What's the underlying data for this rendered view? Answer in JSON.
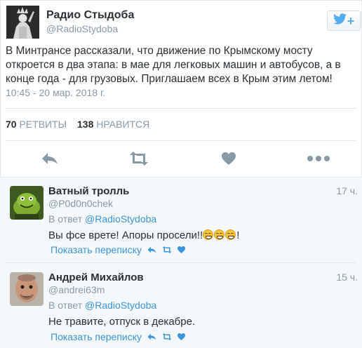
{
  "tweet": {
    "author_name": "Радио Стыдоба",
    "author_handle": "@RadioStydoba",
    "text": "В Минтрансе рассказали, что движение по Крымскому мосту откроется в два этапа: в мае для легковых машин и автобусов, а в конце года - для грузовых. Приглашаем всех в Крым этим летом!",
    "timestamp": "10:45 - 20 мар. 2018 г.",
    "retweets_count": "70",
    "retweets_label": "РЕТВИТЫ",
    "likes_count": "138",
    "likes_label": "НРАВИТСЯ",
    "follow_plus": "+"
  },
  "replies": [
    {
      "name": "Ватный тролль",
      "handle": "@P0d0n0chek",
      "time": "17 ч.",
      "in_reply_prefix": "В ответ",
      "in_reply_to": "@RadioStydoba",
      "text_start": "Вы фсе врете! Апоры просели!!",
      "text_end": "!",
      "show_conversation": "Показать переписку"
    },
    {
      "name": "Андрей Михайлов",
      "handle": "@andrei63m",
      "time": "15 ч.",
      "in_reply_prefix": "В ответ",
      "in_reply_to": "@RadioStydoba",
      "text": "Не травите, отпуск в декабре.",
      "show_conversation": "Показать переписку"
    }
  ],
  "colors": {
    "brand_blue": "#55acee",
    "link_blue": "#3b94d9",
    "muted": "#8899a6",
    "text": "#292f33"
  }
}
